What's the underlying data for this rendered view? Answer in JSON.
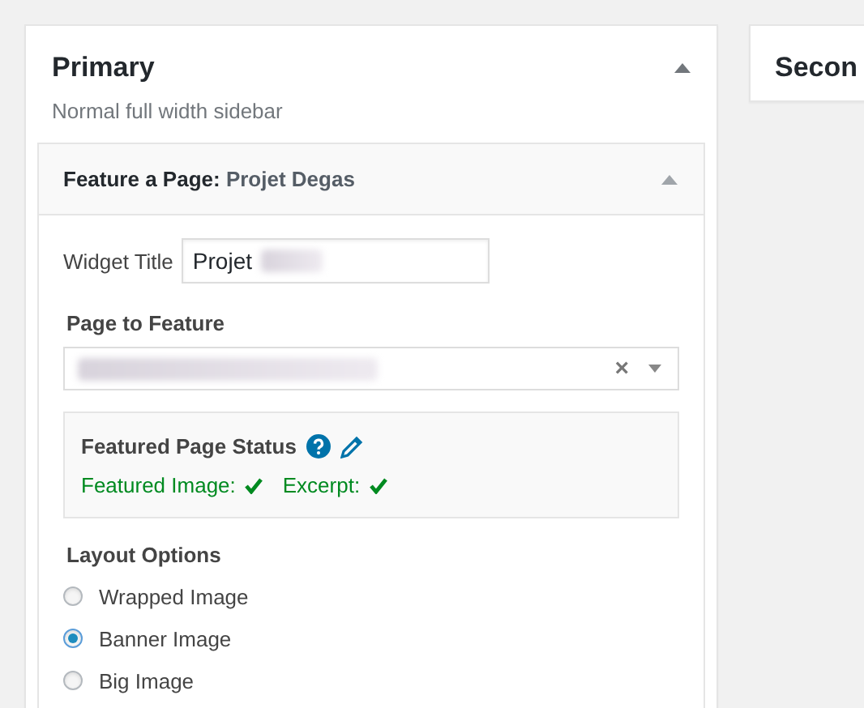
{
  "primary": {
    "title": "Primary",
    "description": "Normal full width sidebar",
    "expanded": true,
    "widget": {
      "type_label": "Feature a Page:",
      "title": "Projet Degas",
      "expanded": true,
      "widget_title": {
        "label": "Widget Title",
        "value": "Projet",
        "redacted": true
      },
      "page_to_feature": {
        "label": "Page to Feature",
        "redacted": true,
        "clear": "×"
      },
      "status": {
        "title": "Featured Page Status",
        "items": [
          {
            "label": "Featured Image:",
            "ok": true
          },
          {
            "label": "Excerpt:",
            "ok": true
          }
        ]
      },
      "layout_options": {
        "label": "Layout Options",
        "options": [
          {
            "label": "Wrapped Image",
            "selected": false
          },
          {
            "label": "Banner Image",
            "selected": true
          },
          {
            "label": "Big Image",
            "selected": false
          }
        ]
      }
    }
  },
  "secondary": {
    "title": "Secon"
  }
}
